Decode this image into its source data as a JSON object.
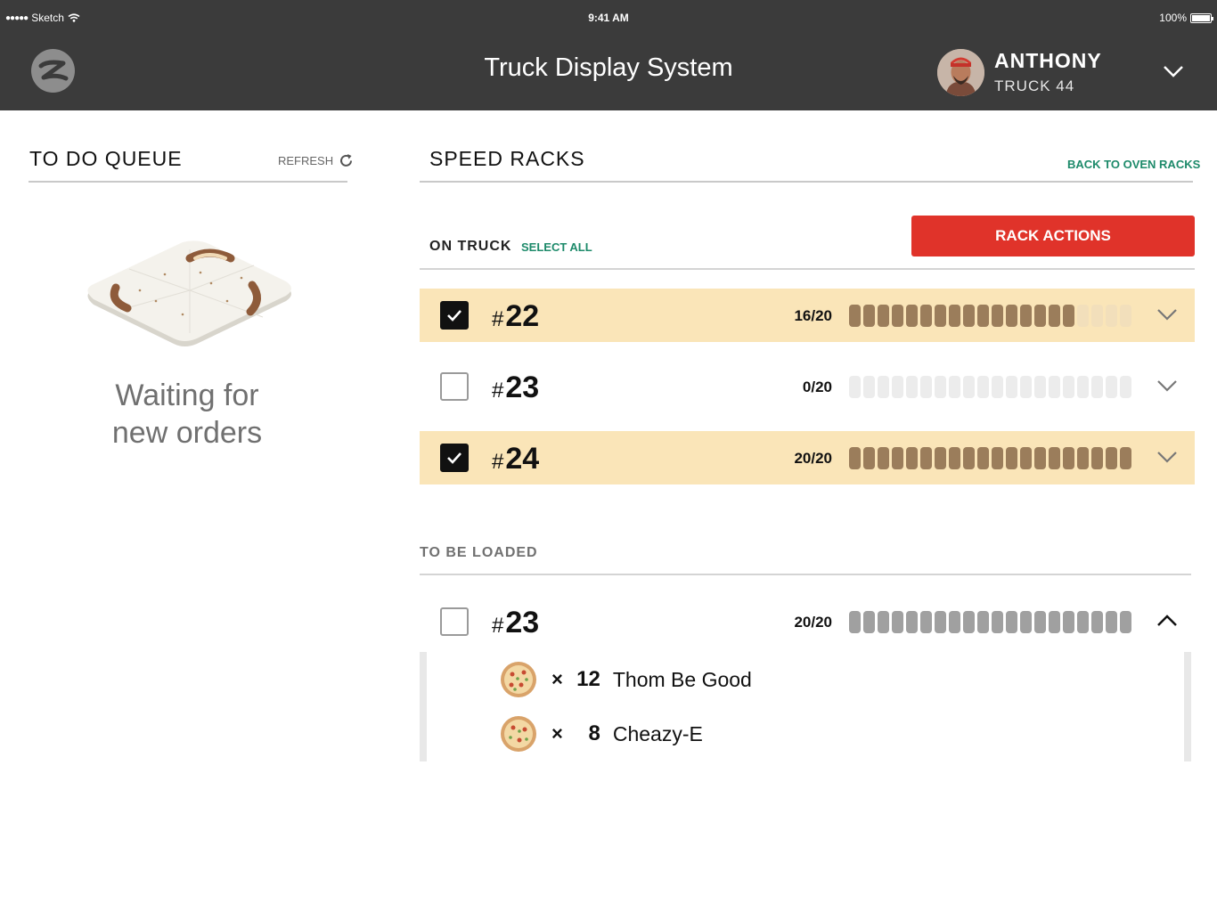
{
  "status_bar": {
    "carrier": "Sketch",
    "signal_dots": "●●●●●",
    "time": "9:41 AM",
    "battery": "100%"
  },
  "header": {
    "title": "Truck Display System",
    "user": {
      "name": "ANTHONY",
      "truck": "TRUCK 44"
    }
  },
  "queue": {
    "title": "TO DO QUEUE",
    "refresh_label": "REFRESH",
    "empty_message_line1": "Waiting for",
    "empty_message_line2": "new orders"
  },
  "racks": {
    "title": "SPEED RACKS",
    "back_link": "BACK TO OVEN RACKS",
    "on_truck_label": "ON TRUCK",
    "select_all_label": "SELECT ALL",
    "rack_actions_label": "RACK ACTIONS",
    "on_truck": [
      {
        "hash": "#",
        "number": "22",
        "count": "16/20",
        "filled": 16,
        "capacity": 20,
        "selected": true
      },
      {
        "hash": "#",
        "number": "23",
        "count": "0/20",
        "filled": 0,
        "capacity": 20,
        "selected": false
      },
      {
        "hash": "#",
        "number": "24",
        "count": "20/20",
        "filled": 20,
        "capacity": 20,
        "selected": true
      }
    ],
    "to_be_loaded_label": "TO BE LOADED",
    "to_be_loaded": [
      {
        "hash": "#",
        "number": "23",
        "count": "20/20",
        "filled": 20,
        "capacity": 20,
        "selected": false,
        "expanded": true,
        "items": [
          {
            "times": "×",
            "qty": "12",
            "name": "Thom Be Good"
          },
          {
            "times": "×",
            "qty": "8",
            "name": "Cheazy-E"
          }
        ]
      }
    ]
  },
  "colors": {
    "header_bg": "#3b3b3b",
    "accent_green": "#1d8a6a",
    "action_red": "#e0332a",
    "selected_row": "#fae5b8",
    "bar_fill": "#9b7d5b"
  }
}
